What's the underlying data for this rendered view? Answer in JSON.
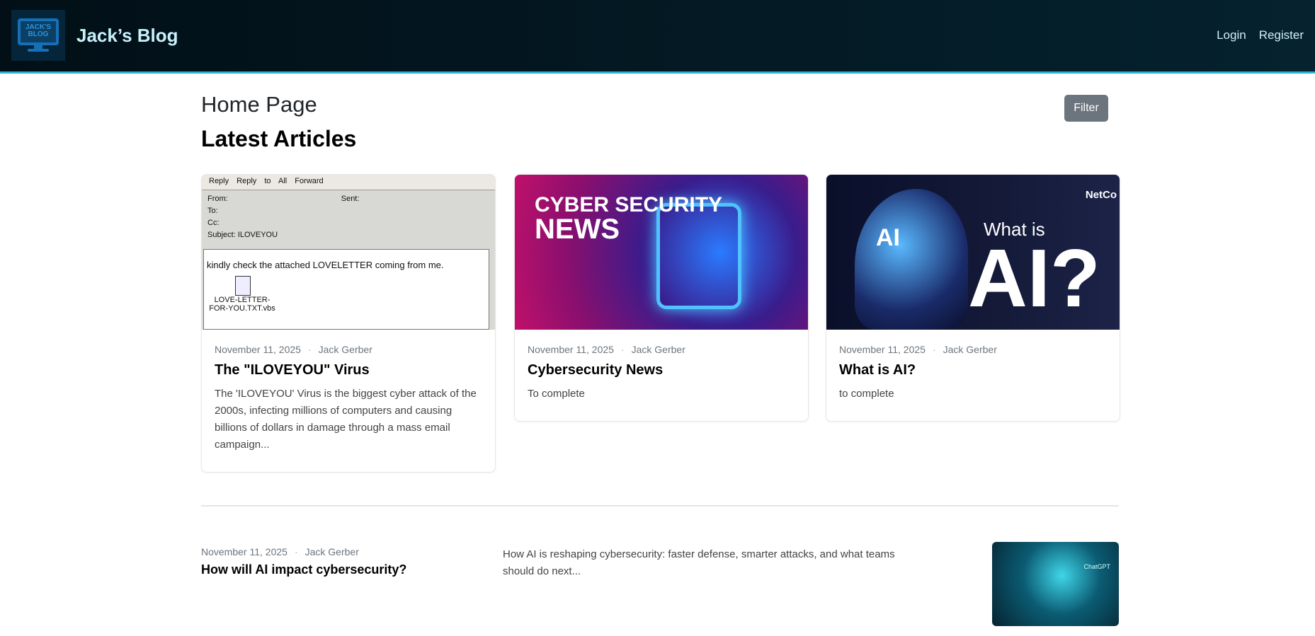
{
  "header": {
    "logo_text": "JACK'S BLOG",
    "title": "Jack’s Blog",
    "nav": [
      {
        "label": "Login"
      },
      {
        "label": "Register"
      }
    ]
  },
  "page": {
    "heading": "Home Page",
    "subheading": "Latest Articles",
    "filter_label": "Filter"
  },
  "articles": [
    {
      "date": "November 11, 2025",
      "author": "Jack Gerber",
      "title": "The \"ILOVEYOU\" Virus",
      "excerpt": "The 'ILOVEYOU' Virus is the biggest cyber attack of the 2000s, infecting millions of computers and causing billions of dollars in damage through a mass email campaign...",
      "image": {
        "toolbar": "Reply Reply to All Forward",
        "from": "From:",
        "sent": "Sent:",
        "to": "To:",
        "cc": "Cc:",
        "subject": "Subject:   ILOVEYOU",
        "body": "kindly check the attached LOVELETTER coming from me.",
        "attachment": "LOVE-LETTER-FOR-YOU.TXT.vbs"
      }
    },
    {
      "date": "November 11, 2025",
      "author": "Jack Gerber",
      "title": "Cybersecurity News",
      "excerpt": "To complete",
      "image": {
        "line1": "CYBER SECURITY",
        "line2": "NEWS"
      }
    },
    {
      "date": "November 11, 2025",
      "author": "Jack Gerber",
      "title": "What is AI?",
      "excerpt": "to complete",
      "image": {
        "badge": "AI",
        "what": "What is",
        "big": "AI?",
        "brand": "NetCo"
      }
    }
  ],
  "posts": [
    {
      "date": "November 11, 2025",
      "author": "Jack Gerber",
      "title": "How will AI impact cybersecurity?",
      "excerpt": "How AI is reshaping cybersecurity: faster defense, smarter attacks, and what teams should do next...",
      "image": {
        "label": "ChatGPT"
      }
    }
  ],
  "colors": {
    "header_bg": "#05222e",
    "accent": "#2bb5d3",
    "brand_text": "#c8f0fa",
    "filter_bg": "#6c757d"
  }
}
